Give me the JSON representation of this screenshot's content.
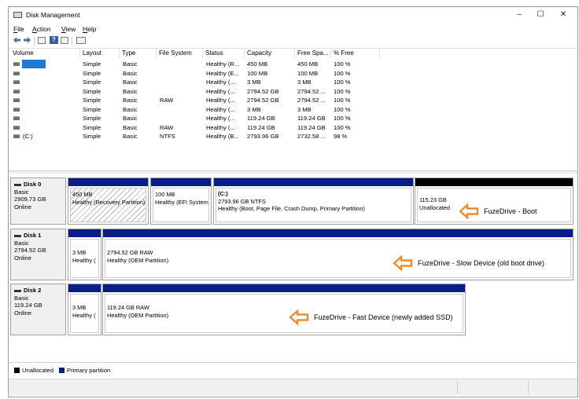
{
  "window": {
    "title": "Disk Management",
    "controls": [
      "–",
      "☐",
      "✕"
    ]
  },
  "menu": [
    {
      "label": "File",
      "underline": "F",
      "rest": "ile"
    },
    {
      "label": "Action",
      "underline": "A",
      "rest": "ction"
    },
    {
      "label": "View",
      "underline": "V",
      "rest": "iew"
    },
    {
      "label": "Help",
      "underline": "H",
      "rest": "elp"
    }
  ],
  "toolbar": {
    "icons": [
      "back-arrow-icon",
      "forward-arrow-icon",
      "properties-icon",
      "help-icon",
      "console-icon",
      "map-icon"
    ]
  },
  "list": {
    "columns": [
      "Volume",
      "Layout",
      "Type",
      "File System",
      "Status",
      "Capacity",
      "Free Spa...",
      "% Free"
    ],
    "rows": [
      {
        "volume": "",
        "selected": true,
        "layout": "Simple",
        "type": "Basic",
        "fs": "",
        "status": "Healthy (R...",
        "capacity": "450 MB",
        "free": "450 MB",
        "pct": "100 %"
      },
      {
        "volume": "",
        "selected": false,
        "layout": "Simple",
        "type": "Basic",
        "fs": "",
        "status": "Healthy (E...",
        "capacity": "100 MB",
        "free": "100 MB",
        "pct": "100 %"
      },
      {
        "volume": "",
        "selected": false,
        "layout": "Simple",
        "type": "Basic",
        "fs": "",
        "status": "Healthy (...",
        "capacity": "3 MB",
        "free": "3 MB",
        "pct": "100 %"
      },
      {
        "volume": "",
        "selected": false,
        "layout": "Simple",
        "type": "Basic",
        "fs": "",
        "status": "Healthy (...",
        "capacity": "2794.52 GB",
        "free": "2794.52 ...",
        "pct": "100 %"
      },
      {
        "volume": "",
        "selected": false,
        "layout": "Simple",
        "type": "Basic",
        "fs": "RAW",
        "status": "Healthy (...",
        "capacity": "2794.52 GB",
        "free": "2794.52 ...",
        "pct": "100 %"
      },
      {
        "volume": "",
        "selected": false,
        "layout": "Simple",
        "type": "Basic",
        "fs": "",
        "status": "Healthy (...",
        "capacity": "3 MB",
        "free": "3 MB",
        "pct": "100 %"
      },
      {
        "volume": "",
        "selected": false,
        "layout": "Simple",
        "type": "Basic",
        "fs": "",
        "status": "Healthy (...",
        "capacity": "119.24 GB",
        "free": "119.24 GB",
        "pct": "100 %"
      },
      {
        "volume": "",
        "selected": false,
        "layout": "Simple",
        "type": "Basic",
        "fs": "RAW",
        "status": "Healthy (...",
        "capacity": "119.24 GB",
        "free": "119.24 GB",
        "pct": "100 %"
      },
      {
        "volume": "(C:)",
        "selected": false,
        "layout": "Simple",
        "type": "Basic",
        "fs": "NTFS",
        "status": "Healthy (B...",
        "capacity": "2793.96 GB",
        "free": "2732.58 ...",
        "pct": "98 %"
      }
    ]
  },
  "disks": [
    {
      "name": "Disk 0",
      "type": "Basic",
      "size": "2909.73 GB",
      "state": "Online",
      "partitions": [
        {
          "line1": "450 MB",
          "line2": "Healthy (Recovery Partition)",
          "line3": ""
        },
        {
          "line1": "100 MB",
          "line2": "Healthy (EFI System Partition)",
          "line3": ""
        },
        {
          "line1": "(C:)",
          "line2": "2793.96 GB NTFS",
          "line3": "Healthy (Boot, Page File, Crash Dump, Primary Partition)"
        },
        {
          "line1": "115.23 GB",
          "line2": "Unallocated",
          "line3": ""
        }
      ],
      "annotation": "FuzeDrive - Boot"
    },
    {
      "name": "Disk 1",
      "type": "Basic",
      "size": "2794.52 GB",
      "state": "Online",
      "partitions": [
        {
          "line1": "3 MB",
          "line2": "Healthy (",
          "line3": ""
        },
        {
          "line1": "2794.52 GB RAW",
          "line2": "Healthy (OEM Partition)",
          "line3": ""
        }
      ],
      "annotation": "FuzeDrive - Slow Device (old boot drive)"
    },
    {
      "name": "Disk 2",
      "type": "Basic",
      "size": "119.24 GB",
      "state": "Online",
      "partitions": [
        {
          "line1": "3 MB",
          "line2": "Healthy (",
          "line3": ""
        },
        {
          "line1": "119.24 GB RAW",
          "line2": "Healthy (OEM Partition)",
          "line3": ""
        }
      ],
      "annotation": "FuzeDrive - Fast Device (newly added SSD)"
    }
  ],
  "legend": [
    {
      "label": "Unallocated",
      "color": "#000000"
    },
    {
      "label": "Primary partition",
      "color": "#0a1e8a"
    }
  ],
  "colors": {
    "primary_bar": "#0a1e8a",
    "unallocated_bar": "#000000",
    "selection": "#1e78d6",
    "annotation_arrow": "#f08c28"
  }
}
